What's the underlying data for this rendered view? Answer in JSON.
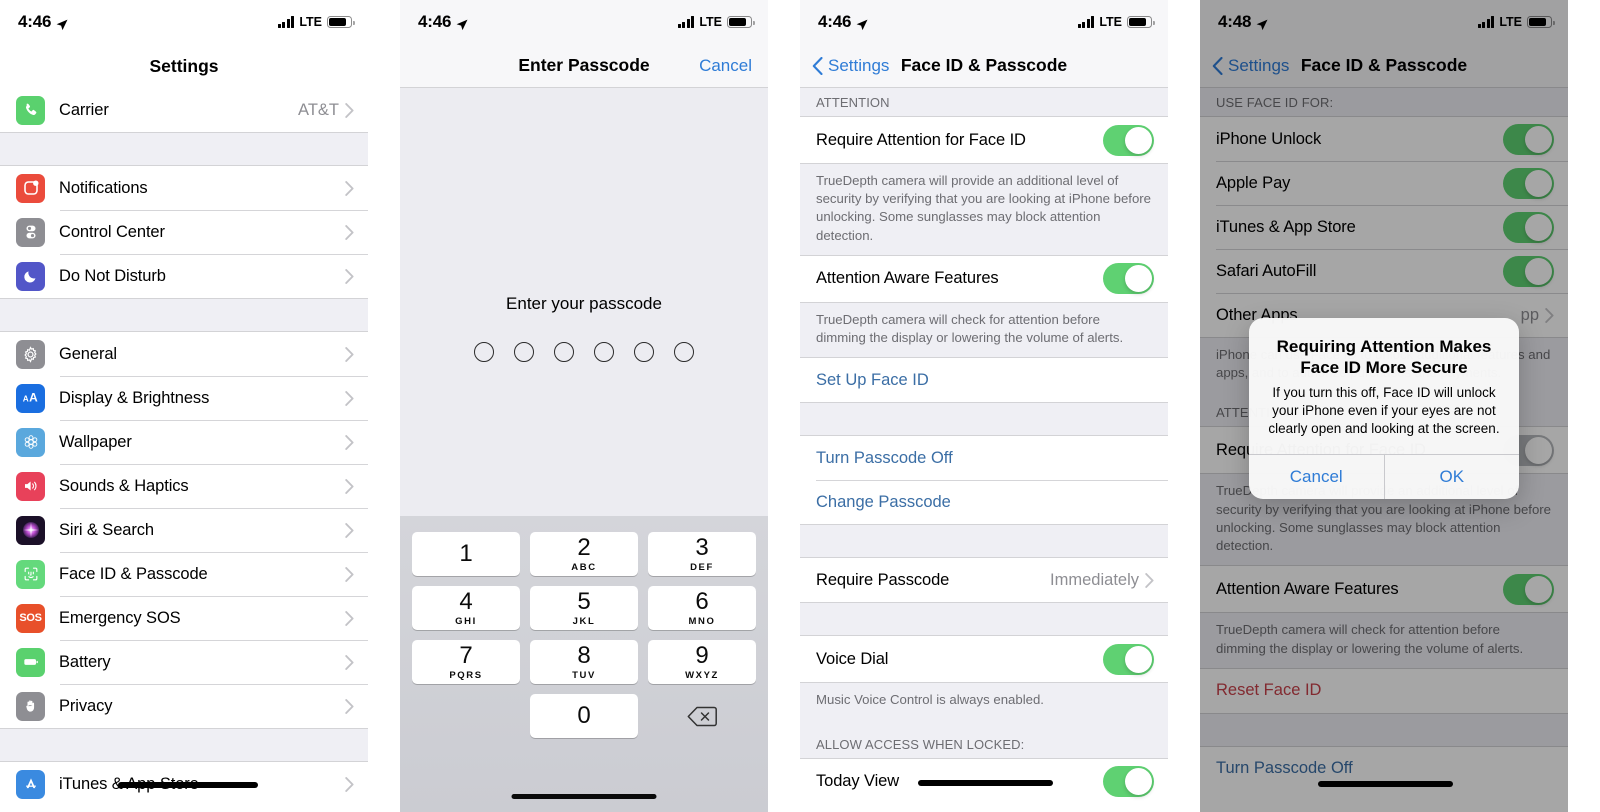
{
  "panels": {
    "p1": {
      "status": {
        "time": "4:46",
        "carrier_type": "LTE"
      },
      "title": "Settings",
      "groups": [
        {
          "rows": [
            {
              "icon": "phone-icon",
              "label": "Carrier",
              "value": "AT&T",
              "accessory": "chevron"
            }
          ]
        },
        {
          "rows": [
            {
              "icon": "notifications-icon",
              "label": "Notifications",
              "value": "",
              "accessory": "chevron"
            },
            {
              "icon": "control-center-icon",
              "label": "Control Center",
              "value": "",
              "accessory": "chevron"
            },
            {
              "icon": "do-not-disturb-icon",
              "label": "Do Not Disturb",
              "value": "",
              "accessory": "chevron"
            }
          ]
        },
        {
          "rows": [
            {
              "icon": "general-gear-icon",
              "label": "General",
              "value": "",
              "accessory": "chevron"
            },
            {
              "icon": "display-brightness-icon",
              "label": "Display & Brightness",
              "value": "",
              "accessory": "chevron"
            },
            {
              "icon": "wallpaper-icon",
              "label": "Wallpaper",
              "value": "",
              "accessory": "chevron"
            },
            {
              "icon": "sounds-haptics-icon",
              "label": "Sounds & Haptics",
              "value": "",
              "accessory": "chevron"
            },
            {
              "icon": "siri-search-icon",
              "label": "Siri & Search",
              "value": "",
              "accessory": "chevron"
            },
            {
              "icon": "face-id-icon",
              "label": "Face ID & Passcode",
              "value": "",
              "accessory": "chevron"
            },
            {
              "icon": "emergency-sos-icon",
              "label": "Emergency SOS",
              "value": "",
              "accessory": "chevron"
            },
            {
              "icon": "battery-icon",
              "label": "Battery",
              "value": "",
              "accessory": "chevron"
            },
            {
              "icon": "privacy-hand-icon",
              "label": "Privacy",
              "value": "",
              "accessory": "chevron"
            }
          ]
        },
        {
          "rows": [
            {
              "icon": "app-store-icon",
              "label": "iTunes & App Store",
              "value": "",
              "accessory": "chevron"
            }
          ]
        }
      ]
    },
    "p2": {
      "status": {
        "time": "4:46",
        "carrier_type": "LTE"
      },
      "title": "Enter Passcode",
      "cancel_label": "Cancel",
      "prompt": "Enter your passcode",
      "dot_count": 6,
      "keypad": [
        {
          "num": "1",
          "letters": ""
        },
        {
          "num": "2",
          "letters": "ABC"
        },
        {
          "num": "3",
          "letters": "DEF"
        },
        {
          "num": "4",
          "letters": "GHI"
        },
        {
          "num": "5",
          "letters": "JKL"
        },
        {
          "num": "6",
          "letters": "MNO"
        },
        {
          "num": "7",
          "letters": "PQRS"
        },
        {
          "num": "8",
          "letters": "TUV"
        },
        {
          "num": "9",
          "letters": "WXYZ"
        },
        {
          "num": "0",
          "letters": ""
        }
      ],
      "delete_key": "delete-backspace-icon"
    },
    "p3": {
      "status": {
        "time": "4:46",
        "carrier_type": "LTE"
      },
      "back_label": "Settings",
      "title": "Face ID & Passcode",
      "section_attention_header": "ATTENTION",
      "require_attention_label": "Require Attention for Face ID",
      "require_attention_footer": "TrueDepth camera will provide an additional level of security by verifying that you are looking at iPhone before unlocking. Some sunglasses may block attention detection.",
      "attention_aware_label": "Attention Aware Features",
      "attention_aware_footer": "TrueDepth camera will check for attention before dimming the display or lowering the volume of alerts.",
      "set_up_face_id": "Set Up Face ID",
      "turn_passcode_off": "Turn Passcode Off",
      "change_passcode": "Change Passcode",
      "require_passcode_label": "Require Passcode",
      "require_passcode_value": "Immediately",
      "voice_dial_label": "Voice Dial",
      "voice_dial_footer": "Music Voice Control is always enabled.",
      "allow_access_header": "ALLOW ACCESS WHEN LOCKED:",
      "today_view_label": "Today View"
    },
    "p4": {
      "status": {
        "time": "4:48",
        "carrier_type": "LTE"
      },
      "back_label": "Settings",
      "title": "Face ID & Passcode",
      "use_face_id_header": "USE FACE ID FOR:",
      "rows": [
        {
          "label": "iPhone Unlock",
          "toggle": true
        },
        {
          "label": "Apple Pay",
          "toggle": true
        },
        {
          "label": "iTunes & App Store",
          "toggle": true
        },
        {
          "label": "Safari AutoFill",
          "toggle": true
        }
      ],
      "other_apps_label": "Other Apps",
      "other_apps_value": "pp",
      "other_apps_footer": "iPhone can use Face ID to unlock additional features and apps, and to authorize purchases and payments.",
      "section_attention_header": "ATTENTION",
      "require_attention_label": "Require Attention for Face ID",
      "require_attention_footer": "TrueDepth camera will provide an additional level of security by verifying that you are looking at iPhone before unlocking. Some sunglasses may block attention detection.",
      "attention_aware_label": "Attention Aware Features",
      "attention_aware_footer": "TrueDepth camera will check for attention before dimming the display or lowering the volume of alerts.",
      "reset_face_id": "Reset Face ID",
      "turn_passcode_off": "Turn Passcode Off",
      "alert": {
        "title": "Requiring Attention Makes Face ID More Secure",
        "message": "If you turn this off, Face ID will unlock your iPhone even if your eyes are not clearly open and looking at the screen.",
        "cancel_label": "Cancel",
        "ok_label": "OK"
      }
    }
  },
  "colors": {
    "toggle_on": "#5fd172",
    "link_blue": "#3b6ea5",
    "nav_blue": "#2f7cd6",
    "destructive_red": "#c8414b",
    "group_bg": "#efeff4",
    "secondary_text": "#8e8e93"
  }
}
